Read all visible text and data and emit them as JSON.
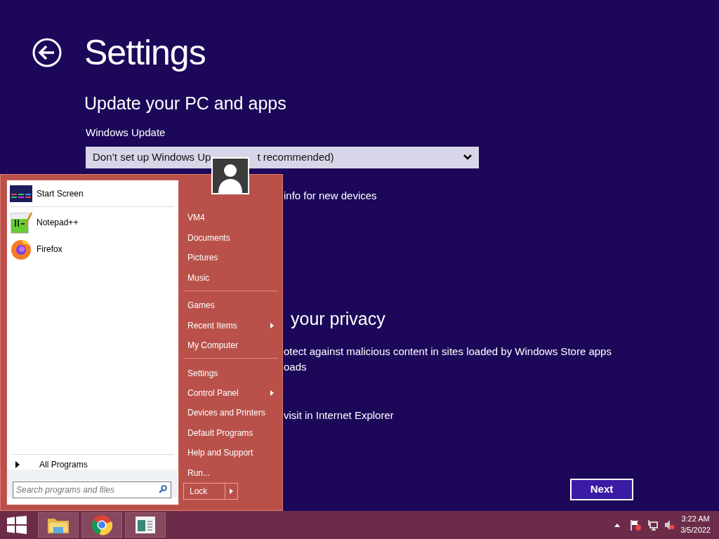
{
  "header": {
    "title": "Settings"
  },
  "update_section": {
    "heading": "Update your PC and apps",
    "label": "Windows Update",
    "dropdown_visible_parts": [
      "Don’t set up Windows Up",
      "t recommended)"
    ],
    "line": "info for new devices"
  },
  "privacy_section": {
    "heading": "your privacy",
    "lines": [
      "otect against malicious content in sites loaded by Windows Store apps",
      "oads",
      "visit in Internet Explorer"
    ]
  },
  "next_button": "Next",
  "start_menu": {
    "pinned": [
      {
        "label": "Start Screen",
        "kind": "start-screen"
      }
    ],
    "recent": [
      {
        "label": "Notepad++",
        "kind": "notepad"
      },
      {
        "label": "Firefox",
        "kind": "firefox"
      }
    ],
    "all_programs": "All Programs",
    "search": {
      "placeholder": "Search programs and files"
    },
    "link_groups": [
      [
        {
          "label": "VM4",
          "submenu": false
        },
        {
          "label": "Documents",
          "submenu": false
        },
        {
          "label": "Pictures",
          "submenu": false
        },
        {
          "label": "Music",
          "submenu": false
        }
      ],
      [
        {
          "label": "Games",
          "submenu": false
        },
        {
          "label": "Recent Items",
          "submenu": true
        },
        {
          "label": "My Computer",
          "submenu": false
        }
      ],
      [
        {
          "label": "Settings",
          "submenu": false
        },
        {
          "label": "Control Panel",
          "submenu": true
        },
        {
          "label": "Devices and Printers",
          "submenu": false
        },
        {
          "label": "Default Programs",
          "submenu": false
        },
        {
          "label": "Help and Support",
          "submenu": false
        },
        {
          "label": "Run...",
          "submenu": false
        }
      ]
    ],
    "lock": "Lock"
  },
  "taskbar": {
    "time": "3:22 AM",
    "date": "3/5/2022"
  }
}
